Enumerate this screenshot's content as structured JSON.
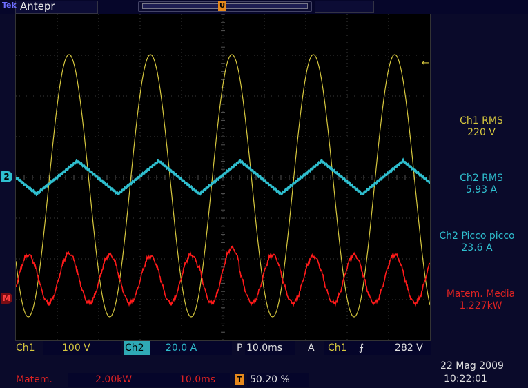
{
  "header": {
    "brand": "Tek",
    "mode": "Antepr",
    "trigger_top_marker": "U",
    "trigger_marker": "T"
  },
  "markers": {
    "ch2": "2",
    "math": "M",
    "trigger_level_arrow": "←"
  },
  "measurements": {
    "ch1_rms_label": "Ch1 RMS",
    "ch1_rms_value": "220 V",
    "ch2_rms_label": "Ch2 RMS",
    "ch2_rms_value": "5.93 A",
    "ch2_pp_label": "Ch2 Picco picco",
    "ch2_pp_value": "23.6 A",
    "math_mean_label": "Matem. Media",
    "math_mean_value": "1.227kW"
  },
  "status": {
    "ch1_name": "Ch1",
    "ch1_scale": "100 V",
    "ch2_name": "Ch2",
    "ch2_scale": "20.0 A",
    "p_label": "P",
    "timebase": "10.0ms",
    "a_label": "A",
    "trigger_source": "Ch1",
    "trigger_slope_icon": "rising-edge",
    "trigger_slope_glyph": "⨍",
    "trigger_level": "282 V",
    "math_name": "Matem.",
    "math_scale": "2.00kW",
    "math_time": "10.0ms",
    "trigger_pos_icon": "T",
    "trigger_position": "50.20 %",
    "date": "22 Mag 2009",
    "time": "10:22:01"
  },
  "colors": {
    "ch1": "#d6c73e",
    "ch2": "#2fbfcf",
    "math": "#ff1a1a",
    "grid": "#3a3a3a",
    "background": "#000000",
    "trigger": "#e6891c"
  }
}
